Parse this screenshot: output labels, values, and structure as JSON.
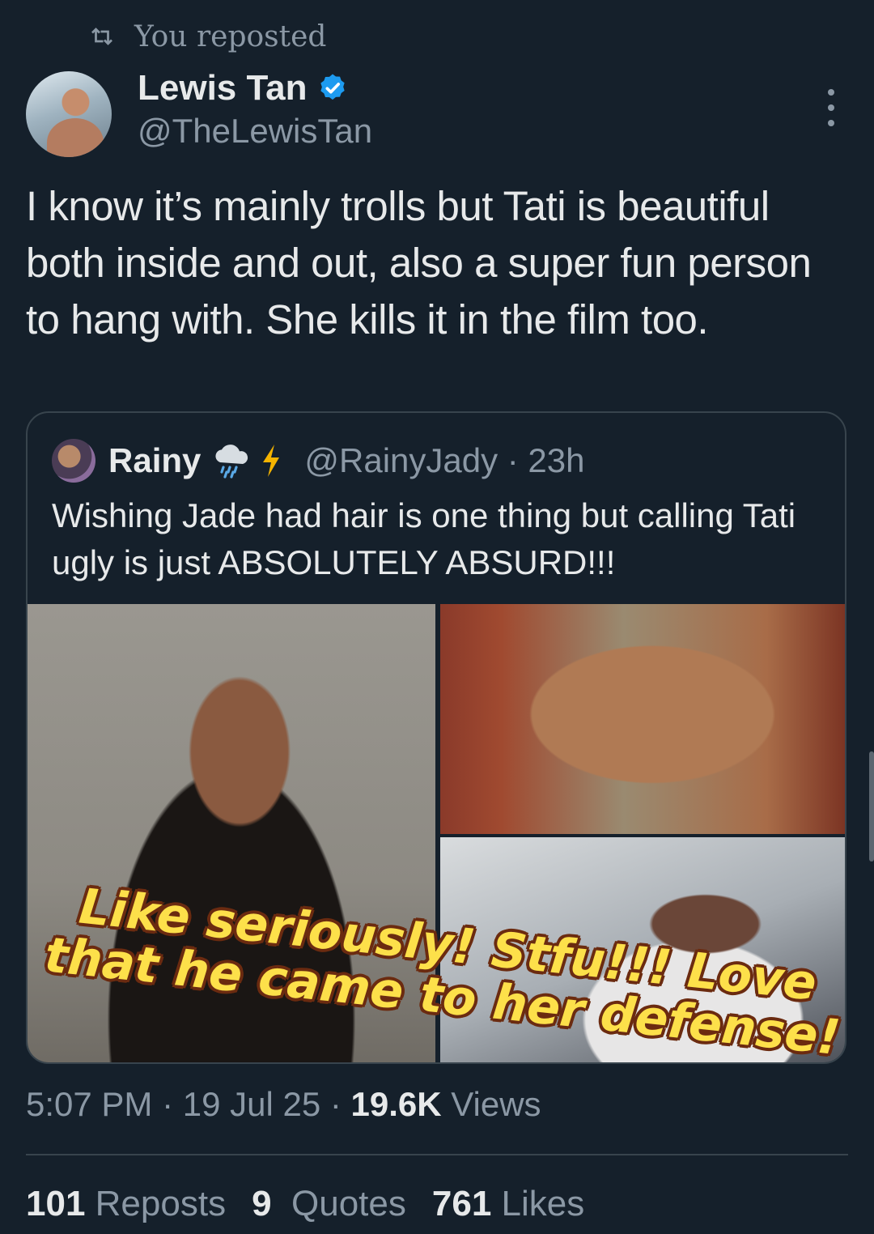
{
  "repost": {
    "text": "You reposted"
  },
  "author": {
    "name": "Lewis Tan",
    "handle": "@TheLewisTan"
  },
  "tweet": {
    "text": "I know it’s mainly trolls but Tati is beautiful both inside and out, also a super fun person to hang with. She kills it in the film too."
  },
  "quote": {
    "name": "Rainy",
    "handle_time": "@RainyJady · 23h",
    "text": "Wishing Jade had hair is one thing but calling Tati ugly is just ABSOLUTELY ABSURD!!!"
  },
  "overlay_caption": "Like seriously! Stfu!!! Love that he came to her defense!",
  "meta": {
    "time_date": "5:07 PM · 19 Jul 25 · ",
    "views_count": "19.6K",
    "views_label": " Views"
  },
  "stats": {
    "reposts_count": "101",
    "reposts_label": "Reposts",
    "quotes_count": "9",
    "quotes_label": "Quotes",
    "likes_count": "761",
    "likes_label": "Likes"
  },
  "colors": {
    "background": "#15202b",
    "text": "#e7e9ea",
    "muted": "#8b98a5",
    "verified": "#1d9bf0",
    "caption": "#fde04a"
  },
  "icons": [
    "repost-icon",
    "verified-badge-icon",
    "more-icon",
    "rain-cloud-icon",
    "lightning-icon"
  ]
}
